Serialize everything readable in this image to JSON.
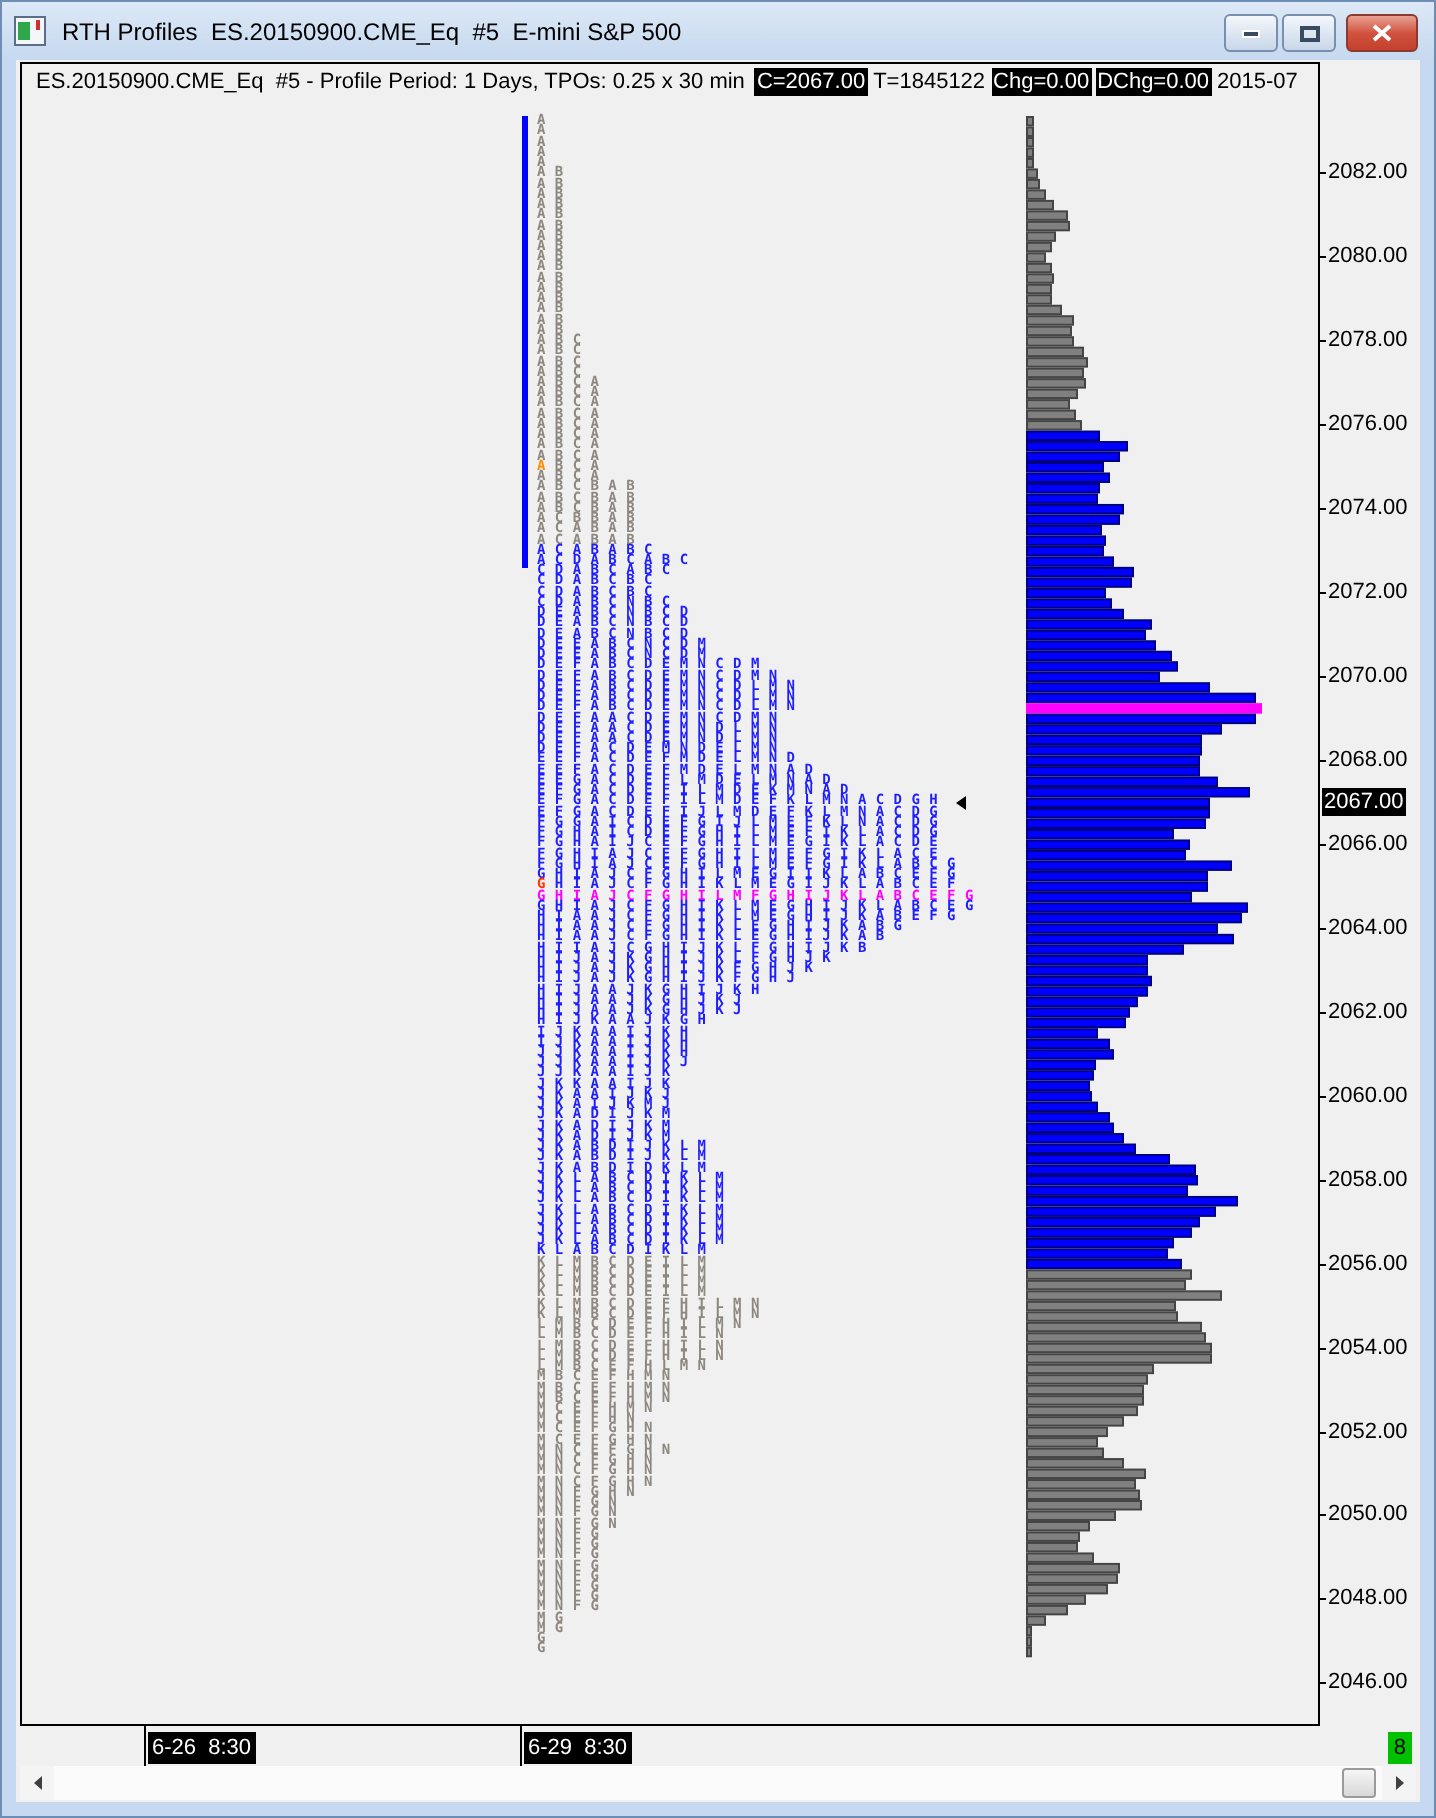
{
  "window": {
    "title": "RTH Profiles  ES.20150900.CME_Eq  #5  E-mini S&P 500"
  },
  "header": {
    "description": "ES.20150900.CME_Eq  #5 - Profile Period: 1 Days, TPOs: 0.25 x 30 min",
    "stats": [
      {
        "text": "C=2067.00",
        "highlighted": true
      },
      {
        "text": "T=1845122",
        "highlighted": false
      },
      {
        "text": "Chg=0.00",
        "highlighted": true
      },
      {
        "text": "DChg=0.00",
        "highlighted": true
      },
      {
        "text": "2015-07",
        "highlighted": false
      }
    ]
  },
  "profile": {
    "rows": [
      {
        "letters": "A",
        "color": "#8d8880",
        "kind": "plain"
      },
      {
        "letters": "A",
        "color": "#8d8880",
        "kind": "plain"
      },
      {
        "letters": "A",
        "color": "#8d8880",
        "kind": "plain"
      },
      {
        "letters": "A",
        "color": "#8d8880",
        "kind": "plain"
      },
      {
        "letters": "A",
        "color": "#8d8880",
        "kind": "plain"
      },
      {
        "letters": "AB",
        "color": "#8d8880",
        "kind": "plain"
      },
      {
        "letters": "AB",
        "color": "#8d8880",
        "kind": "plain"
      },
      {
        "letters": "AB",
        "color": "#8d8880",
        "kind": "plain"
      },
      {
        "letters": "AB",
        "color": "#8d8880",
        "kind": "plain"
      },
      {
        "letters": "AB",
        "color": "#8d8880",
        "kind": "plain"
      },
      {
        "letters": "AB",
        "color": "#8d8880",
        "kind": "plain"
      },
      {
        "letters": "AB",
        "color": "#8d8880",
        "kind": "plain"
      },
      {
        "letters": "AB",
        "color": "#8d8880",
        "kind": "plain"
      },
      {
        "letters": "AB",
        "color": "#8d8880",
        "kind": "plain"
      },
      {
        "letters": "AB",
        "color": "#8d8880",
        "kind": "plain"
      },
      {
        "letters": "AB",
        "color": "#8d8880",
        "kind": "plain"
      },
      {
        "letters": "AB",
        "color": "#8d8880",
        "kind": "plain"
      },
      {
        "letters": "AB",
        "color": "#8d8880",
        "kind": "plain"
      },
      {
        "letters": "AB",
        "color": "#8d8880",
        "kind": "plain"
      },
      {
        "letters": "AB",
        "color": "#8d8880",
        "kind": "plain"
      },
      {
        "letters": "AB",
        "color": "#8d8880",
        "kind": "plain"
      },
      {
        "letters": "ABC",
        "color": "#8d8880",
        "kind": "plain"
      },
      {
        "letters": "ABC",
        "color": "#8d8880",
        "kind": "plain"
      },
      {
        "letters": "ABC",
        "color": "#8d8880",
        "kind": "plain"
      },
      {
        "letters": "ABC",
        "color": "#8d8880",
        "kind": "plain"
      },
      {
        "letters": "ABCA",
        "color": "#8d8880",
        "kind": "plain"
      },
      {
        "letters": "ABCA",
        "color": "#8d8880",
        "kind": "plain"
      },
      {
        "letters": "ABCA",
        "color": "#8d8880",
        "kind": "plain"
      },
      {
        "letters": "ABCA",
        "color": "#8d8880",
        "kind": "plain"
      },
      {
        "letters": "ABCA",
        "color": "#8d8880",
        "kind": "plain"
      },
      {
        "letters": "ABCA",
        "color": "#8d8880",
        "kind": "plain"
      },
      {
        "letters": "ABCA",
        "color": "#8d8880",
        "kind": "plain"
      },
      {
        "letters": "ABCA",
        "color": "#8d8880",
        "kind": "plain"
      },
      {
        "letters": "ABCA",
        "color": "#8d8880",
        "kind": "open"
      },
      {
        "letters": "ABCA",
        "color": "#8d8880",
        "kind": "plain"
      },
      {
        "letters": "ABCBAB",
        "color": "#8d8880",
        "kind": "plain"
      },
      {
        "letters": "ABCBAB",
        "color": "#8d8880",
        "kind": "plain"
      },
      {
        "letters": "ABCBAB",
        "color": "#8d8880",
        "kind": "plain"
      },
      {
        "letters": "ACBBAB",
        "color": "#8d8880",
        "kind": "plain"
      },
      {
        "letters": "ACABAB",
        "color": "#8d8880",
        "kind": "plain"
      },
      {
        "letters": "ACABAB",
        "color": "#8d8880",
        "kind": "plain"
      },
      {
        "letters": "ACABABC",
        "color": "#1e1eff",
        "kind": "plain"
      },
      {
        "letters": "ACDABCABC",
        "color": "#1e1eff",
        "kind": "plain"
      },
      {
        "letters": "CDABCABC",
        "color": "#1e1eff",
        "kind": "plain"
      },
      {
        "letters": "CDABCBC",
        "color": "#1e1eff",
        "kind": "plain"
      },
      {
        "letters": "CDABCBC",
        "color": "#1e1eff",
        "kind": "plain"
      },
      {
        "letters": "CDABCNBC",
        "color": "#1e1eff",
        "kind": "plain"
      },
      {
        "letters": "DEABCNBCD",
        "color": "#1e1eff",
        "kind": "plain"
      },
      {
        "letters": "DEABCNBCD",
        "color": "#1e1eff",
        "kind": "plain"
      },
      {
        "letters": "DEABCNBCD",
        "color": "#1e1eff",
        "kind": "plain"
      },
      {
        "letters": "DEEABCNCDM",
        "color": "#1e1eff",
        "kind": "plain"
      },
      {
        "letters": "DEEABCNCDM",
        "color": "#1e1eff",
        "kind": "plain"
      },
      {
        "letters": "DEFABCDEMNCDM",
        "color": "#1e1eff",
        "kind": "plain"
      },
      {
        "letters": "DEFABCDEMNCDMN",
        "color": "#1e1eff",
        "kind": "plain"
      },
      {
        "letters": "DEFABCDEMNCDLMN",
        "color": "#1e1eff",
        "kind": "plain"
      },
      {
        "letters": "DEFABCDEMNCDLMN",
        "color": "#1e1eff",
        "kind": "plain"
      },
      {
        "letters": "DEFABCDEMNCDLMN",
        "color": "#1e1eff",
        "kind": "plain"
      },
      {
        "letters": "DEFAACDEMNCDMN",
        "color": "#1e1eff",
        "kind": "plain"
      },
      {
        "letters": "DEFAACDEMNDLMN",
        "color": "#1e1eff",
        "kind": "plain"
      },
      {
        "letters": "DEFAACDEMNDLMN",
        "color": "#1e1eff",
        "kind": "plain"
      },
      {
        "letters": "DEFACDEMNDELMN",
        "color": "#1e1eff",
        "kind": "plain"
      },
      {
        "letters": "EEFACDEFMDELMND",
        "color": "#1e1eff",
        "kind": "plain"
      },
      {
        "letters": "EEFACDEFMDELMNAD",
        "color": "#1e1eff",
        "kind": "plain"
      },
      {
        "letters": "EEGACDEFLMDELMNAD",
        "color": "#1e1eff",
        "kind": "plain"
      },
      {
        "letters": "EFGACDEFILMDEKMNAD",
        "color": "#1e1eff",
        "kind": "plain"
      },
      {
        "letters": "EFGACDEFILMDEFKLMNACDGH",
        "color": "#1e1eff",
        "kind": "current"
      },
      {
        "letters": "EFGACDEFIJLMDEFKLMNACDG",
        "color": "#1e1eff",
        "kind": "plain"
      },
      {
        "letters": "FGGAICDEFGIJLMEFKLNACDG",
        "color": "#1e1eff",
        "kind": "plain"
      },
      {
        "letters": "FGHAICDEFGHILMEFIKLACDG",
        "color": "#1e1eff",
        "kind": "plain"
      },
      {
        "letters": "FGHAIJCEFGHILMEGIKLACDE",
        "color": "#1e1eff",
        "kind": "plain"
      },
      {
        "letters": "FGHIAJCEFGHILMEFGIKLACE",
        "color": "#1e1eff",
        "kind": "plain"
      },
      {
        "letters": "FGHIAJCEFGHILMEFGIKLABCG",
        "color": "#1e1eff",
        "kind": "plain"
      },
      {
        "letters": "GHIAJCFGHILMEGIIKLABCEFG",
        "color": "#1e1eff",
        "kind": "plain"
      },
      {
        "letters": "GHIAJCFGHIKLMEGIJKLABCEF",
        "color": "#1e1eff",
        "kind": "close"
      },
      {
        "letters": "GHIAJCFGHILMFGHIJKLABCEFG",
        "color": "#ff00ff",
        "kind": "plain"
      },
      {
        "letters": "GHIAJCFGHIKLMEGHIJKLABCEG",
        "color": "#1e1eff",
        "kind": "plain"
      },
      {
        "letters": "HIAAJCFGHIKLMEGHIJKABEFG",
        "color": "#1e1eff",
        "kind": "plain"
      },
      {
        "letters": "HIAAJCFGHIKLEGHIJKABG",
        "color": "#1e1eff",
        "kind": "plain"
      },
      {
        "letters": "HIAAJCFGHIKLEGHIJKAB",
        "color": "#1e1eff",
        "kind": "plain"
      },
      {
        "letters": "HIIAJCGHIJKLFGHIJKB",
        "color": "#1e1eff",
        "kind": "plain"
      },
      {
        "letters": "HIJAJKGHIJKLFGHJK",
        "color": "#1e1eff",
        "kind": "plain"
      },
      {
        "letters": "HIJAJKGHIJKFGHJK",
        "color": "#1e1eff",
        "kind": "plain"
      },
      {
        "letters": "HIJAJKGHIJKFGHJ",
        "color": "#1e1eff",
        "kind": "plain"
      },
      {
        "letters": "HIJAAJKGHIJKH",
        "color": "#1e1eff",
        "kind": "plain"
      },
      {
        "letters": "HIJAAJKGHJKJ",
        "color": "#1e1eff",
        "kind": "plain"
      },
      {
        "letters": "HIJAAJKGHJKJ",
        "color": "#1e1eff",
        "kind": "plain"
      },
      {
        "letters": "HIJKAAJKGH",
        "color": "#1e1eff",
        "kind": "plain"
      },
      {
        "letters": "IJKAAIJKH",
        "color": "#1e1eff",
        "kind": "plain"
      },
      {
        "letters": "IJKAAIJKH",
        "color": "#1e1eff",
        "kind": "plain"
      },
      {
        "letters": "JJKAAIJKH",
        "color": "#1e1eff",
        "kind": "plain"
      },
      {
        "letters": "JJKAAIJKJ",
        "color": "#1e1eff",
        "kind": "plain"
      },
      {
        "letters": "JJKAAIJK",
        "color": "#1e1eff",
        "kind": "plain"
      },
      {
        "letters": "JKKAAIJK",
        "color": "#1e1eff",
        "kind": "plain"
      },
      {
        "letters": "JKAAIJKJ",
        "color": "#1e1eff",
        "kind": "plain"
      },
      {
        "letters": "JKAIJKMJ",
        "color": "#1e1eff",
        "kind": "plain"
      },
      {
        "letters": "JKADIJKM",
        "color": "#1e1eff",
        "kind": "plain"
      },
      {
        "letters": "JKADIJKM",
        "color": "#1e1eff",
        "kind": "plain"
      },
      {
        "letters": "JKADIJKM",
        "color": "#1e1eff",
        "kind": "plain"
      },
      {
        "letters": "JKABDIJKLM",
        "color": "#1e1eff",
        "kind": "plain"
      },
      {
        "letters": "JKABDIJKLM",
        "color": "#1e1eff",
        "kind": "plain"
      },
      {
        "letters": "JKABDIDKLM",
        "color": "#1e1eff",
        "kind": "plain"
      },
      {
        "letters": "JKLABCDIKLM",
        "color": "#1e1eff",
        "kind": "plain"
      },
      {
        "letters": "JKLABCDIKLM",
        "color": "#1e1eff",
        "kind": "plain"
      },
      {
        "letters": "JKLABCDIKLM",
        "color": "#1e1eff",
        "kind": "plain"
      },
      {
        "letters": "JKLABCDIKLM",
        "color": "#1e1eff",
        "kind": "plain"
      },
      {
        "letters": "JKLABCDIKLM",
        "color": "#1e1eff",
        "kind": "plain"
      },
      {
        "letters": "JKLABCDIKLM",
        "color": "#1e1eff",
        "kind": "plain"
      },
      {
        "letters": "JKLABCDIKLM",
        "color": "#1e1eff",
        "kind": "plain"
      },
      {
        "letters": "KLABCDIKLM",
        "color": "#1e1eff",
        "kind": "plain"
      },
      {
        "letters": "KLMBCDEILM",
        "color": "#8d8880",
        "kind": "plain"
      },
      {
        "letters": "KLMBCDEILM",
        "color": "#8d8880",
        "kind": "plain"
      },
      {
        "letters": "KLMBCDEILM",
        "color": "#8d8880",
        "kind": "plain"
      },
      {
        "letters": "KLMBCDEILM",
        "color": "#8d8880",
        "kind": "plain"
      },
      {
        "letters": "KLMBCDEFHILMN",
        "color": "#8d8880",
        "kind": "plain"
      },
      {
        "letters": "KLMBCDEFHILMN",
        "color": "#8d8880",
        "kind": "plain"
      },
      {
        "letters": "LMBCDEFHILMN",
        "color": "#8d8880",
        "kind": "plain"
      },
      {
        "letters": "LMBCDEFHILN",
        "color": "#8d8880",
        "kind": "plain"
      },
      {
        "letters": "LMBCDEFHILN",
        "color": "#8d8880",
        "kind": "plain"
      },
      {
        "letters": "LMBCDEFHILN",
        "color": "#8d8880",
        "kind": "plain"
      },
      {
        "letters": "LMBCEFHLMN",
        "color": "#8d8880",
        "kind": "plain"
      },
      {
        "letters": "MBCEFHMN",
        "color": "#8d8880",
        "kind": "plain"
      },
      {
        "letters": "MBCEFHMN",
        "color": "#8d8880",
        "kind": "plain"
      },
      {
        "letters": "MBCEFHMN",
        "color": "#8d8880",
        "kind": "plain"
      },
      {
        "letters": "MCEFHMN",
        "color": "#8d8880",
        "kind": "plain"
      },
      {
        "letters": "MCEFHN",
        "color": "#8d8880",
        "kind": "plain"
      },
      {
        "letters": "MCEFGHN",
        "color": "#8d8880",
        "kind": "plain"
      },
      {
        "letters": "MCEFGHN",
        "color": "#8d8880",
        "kind": "plain"
      },
      {
        "letters": "MNCEFGHN",
        "color": "#8d8880",
        "kind": "plain"
      },
      {
        "letters": "MNCFGHN",
        "color": "#8d8880",
        "kind": "plain"
      },
      {
        "letters": "MNCFGHN",
        "color": "#8d8880",
        "kind": "plain"
      },
      {
        "letters": "MNCFGHN",
        "color": "#8d8880",
        "kind": "plain"
      },
      {
        "letters": "MNFGHN",
        "color": "#8d8880",
        "kind": "plain"
      },
      {
        "letters": "MNFGN",
        "color": "#8d8880",
        "kind": "plain"
      },
      {
        "letters": "MNFGN",
        "color": "#8d8880",
        "kind": "plain"
      },
      {
        "letters": "MNFGN",
        "color": "#8d8880",
        "kind": "plain"
      },
      {
        "letters": "MNFG",
        "color": "#8d8880",
        "kind": "plain"
      },
      {
        "letters": "MNFG",
        "color": "#8d8880",
        "kind": "plain"
      },
      {
        "letters": "MNFG",
        "color": "#8d8880",
        "kind": "plain"
      },
      {
        "letters": "MNFG",
        "color": "#8d8880",
        "kind": "plain"
      },
      {
        "letters": "MNFG",
        "color": "#8d8880",
        "kind": "plain"
      },
      {
        "letters": "MNFG",
        "color": "#8d8880",
        "kind": "plain"
      },
      {
        "letters": "MNFG",
        "color": "#8d8880",
        "kind": "plain"
      },
      {
        "letters": "MNFG",
        "color": "#8d8880",
        "kind": "plain"
      },
      {
        "letters": "MG",
        "color": "#8d8880",
        "kind": "plain"
      },
      {
        "letters": "MG",
        "color": "#8d8880",
        "kind": "plain"
      },
      {
        "letters": "G",
        "color": "#8d8880",
        "kind": "plain"
      },
      {
        "letters": "G",
        "color": "#8d8880",
        "kind": "plain"
      }
    ]
  },
  "price_axis": {
    "labels": [
      "2082.00",
      "2080.00",
      "2078.00",
      "2076.00",
      "2074.00",
      "2072.00",
      "2070.00",
      "2068.00",
      "2066.00",
      "2064.00",
      "2062.00",
      "2060.00",
      "2058.00",
      "2056.00",
      "2054.00",
      "2052.00",
      "2050.00",
      "2048.00",
      "2046.00"
    ],
    "current": "2067.00"
  },
  "time_axis": {
    "labels": [
      "6-26  8:30",
      "6-29  8:30"
    ]
  },
  "indicator": "8"
}
